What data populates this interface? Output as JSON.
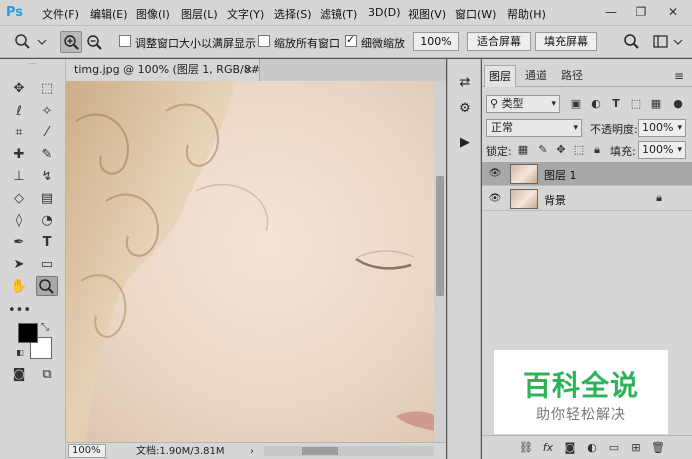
{
  "app": {
    "logo": "Ps"
  },
  "menu": [
    "文件(F)",
    "编辑(E)",
    "图像(I)",
    "图层(L)",
    "文字(Y)",
    "选择(S)",
    "滤镜(T)",
    "3D(D)",
    "视图(V)",
    "窗口(W)",
    "帮助(H)"
  ],
  "window_controls": {
    "minimize": "—",
    "restore": "❐",
    "close": "✕"
  },
  "options": {
    "resize_windows": {
      "label": "调整窗口大小以满屏显示",
      "checked": false
    },
    "zoom_all_windows": {
      "label": "缩放所有窗口",
      "checked": false
    },
    "scrubby_zoom": {
      "label": "细微缩放",
      "checked": true
    },
    "zoom_value": "100%",
    "fit_screen": "适合屏幕",
    "fill_screen": "填充屏幕"
  },
  "document": {
    "tab_title": "timg.jpg @ 100% (图层 1, RGB/8#) *",
    "close": "×",
    "zoom": "100%",
    "doc_info": "文档:1.90M/3.81M"
  },
  "panels": {
    "tabs": [
      "图层",
      "通道",
      "路径"
    ],
    "active_tab": "图层",
    "kind_filter": "类型",
    "blend_mode": "正常",
    "opacity_label": "不透明度:",
    "opacity_value": "100%",
    "lock_label": "锁定:",
    "fill_label": "填充:",
    "fill_value": "100%",
    "layers": [
      {
        "name": "图层 1",
        "selected": true,
        "locked": false
      },
      {
        "name": "背景",
        "selected": false,
        "locked": true
      }
    ]
  },
  "watermark": {
    "title": "百科全说",
    "subtitle": "助你轻松解决"
  },
  "colors": {
    "foreground": "#000000",
    "background": "#ffffff",
    "watermark_green": "#2cb35a",
    "logo_blue": "#2e9ae8"
  }
}
